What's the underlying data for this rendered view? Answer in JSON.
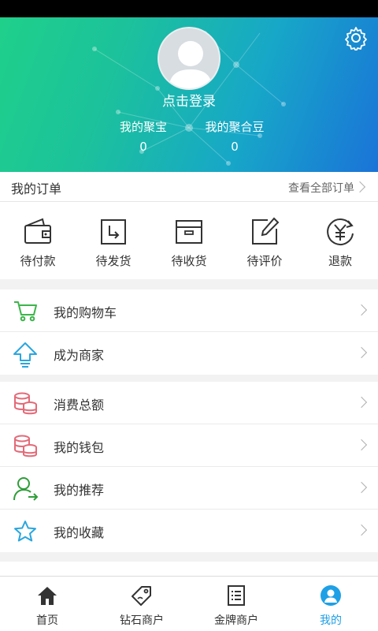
{
  "profile": {
    "login_text": "点击登录",
    "stats": [
      {
        "label": "我的聚宝",
        "value": "0"
      },
      {
        "label": "我的聚合豆",
        "value": "0"
      }
    ]
  },
  "orders": {
    "title": "我的订单",
    "view_all": "查看全部订单",
    "items": [
      {
        "label": "待付款",
        "icon": "wallet-icon"
      },
      {
        "label": "待发货",
        "icon": "ship-box-icon"
      },
      {
        "label": "待收货",
        "icon": "receive-box-icon"
      },
      {
        "label": "待评价",
        "icon": "edit-icon"
      },
      {
        "label": "退款",
        "icon": "refund-yen-icon"
      }
    ]
  },
  "menu_group1": [
    {
      "label": "我的购物车",
      "icon": "cart-icon"
    },
    {
      "label": "成为商家",
      "icon": "upload-arrow-icon"
    }
  ],
  "menu_group2": [
    {
      "label": "消费总额",
      "icon": "coins-icon"
    },
    {
      "label": "我的钱包",
      "icon": "coins-icon"
    },
    {
      "label": "我的推荐",
      "icon": "user-refer-icon"
    },
    {
      "label": "我的收藏",
      "icon": "star-icon"
    }
  ],
  "tabs": [
    {
      "label": "首页",
      "icon": "home-icon"
    },
    {
      "label": "钻石商户",
      "icon": "tag-icon"
    },
    {
      "label": "金牌商户",
      "icon": "list-icon"
    },
    {
      "label": "我的",
      "icon": "profile-icon",
      "active": true
    }
  ],
  "colors": {
    "accent": "#1ea0e6",
    "header_start": "#1fd08a",
    "header_end": "#1a73d8"
  }
}
